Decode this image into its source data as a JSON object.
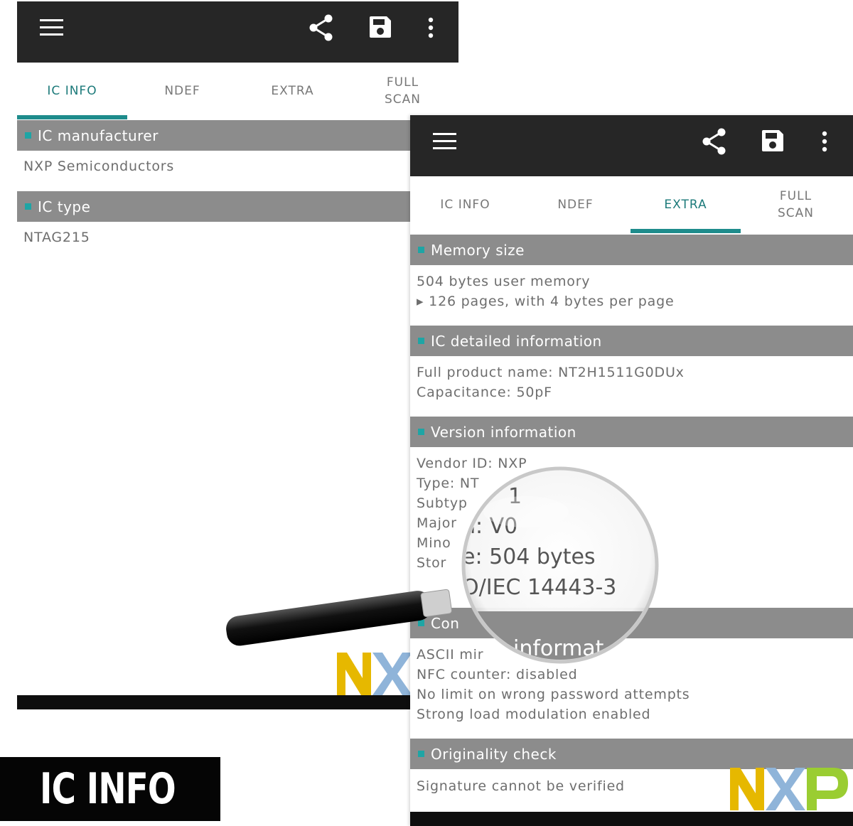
{
  "left_screen": {
    "tabs": [
      {
        "label": "IC INFO",
        "active": true
      },
      {
        "label": "NDEF",
        "active": false
      },
      {
        "label": "EXTRA",
        "active": false
      },
      {
        "label": "FULL\nSCAN",
        "active": false
      }
    ],
    "sections": [
      {
        "title": "IC manufacturer",
        "lines": [
          "NXP Semiconductors"
        ]
      },
      {
        "title": "IC type",
        "lines": [
          "NTAG215"
        ]
      }
    ]
  },
  "right_screen": {
    "tabs": [
      {
        "label": "IC INFO",
        "active": false
      },
      {
        "label": "NDEF",
        "active": false
      },
      {
        "label": "EXTRA",
        "active": true
      },
      {
        "label": "FULL\nSCAN",
        "active": false
      }
    ],
    "sections": [
      {
        "title": "Memory size",
        "lines": [
          "504 bytes user memory",
          "▸ 126 pages, with 4 bytes per page"
        ]
      },
      {
        "title": "IC detailed information",
        "lines": [
          "Full product name: NT2H1511G0DUx",
          "Capacitance: 50pF"
        ]
      },
      {
        "title": "Version information",
        "lines": [
          "Vendor ID: NXP",
          "Type: NT",
          "Subtyp",
          "Major",
          "Mino",
          "Stor"
        ]
      },
      {
        "title": "Con",
        "lines": [
          "ASCII mir",
          "NFC counter: disabled",
          "No limit on wrong password attempts",
          "Strong load modulation enabled"
        ]
      },
      {
        "title": "Originality check",
        "lines": [
          "Signature cannot be verified"
        ]
      }
    ]
  },
  "magnifier": {
    "lines": [
      "1",
      "n: V0",
      "e: 504 bytes",
      "O/IEC 14443-3"
    ],
    "header_fragment": "informat"
  },
  "logo_text": "NXP",
  "banner": {
    "label": "IC INFO"
  },
  "icons": {
    "menu": "menu-icon",
    "share": "share-icon",
    "save": "save-icon",
    "more": "more-vert-icon"
  },
  "colors": {
    "appbar": "#262626",
    "accent": "#1e8c8c",
    "section_header": "#8c8c8c",
    "logo_yellow": "#e6b800",
    "logo_blue": "#8fb4d9",
    "logo_green": "#9acd32"
  }
}
